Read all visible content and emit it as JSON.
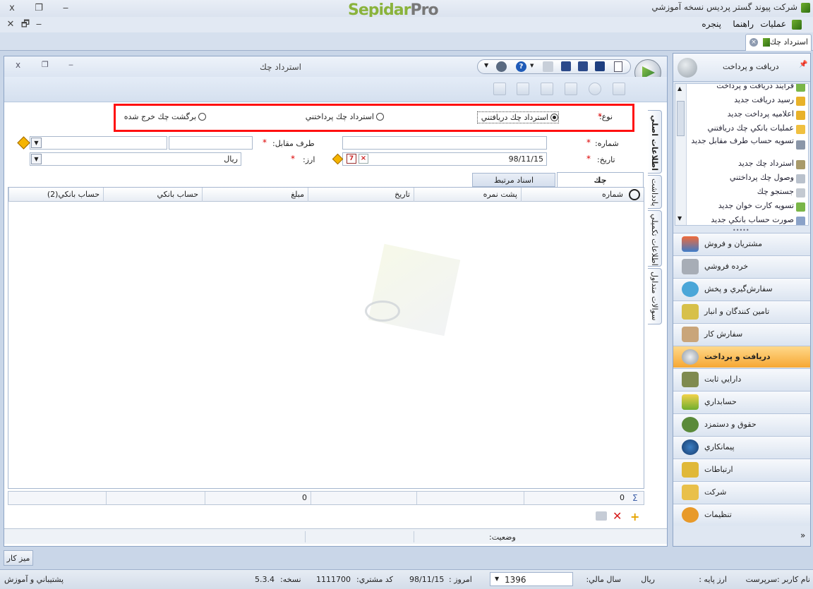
{
  "window": {
    "title": "شرکت پیوند گستر پردیس نسخه آموزشي",
    "logo_part1": "Sepidar",
    "logo_part2": "Pro",
    "close": "x",
    "restore": "❐",
    "minimize": "‒"
  },
  "menu": {
    "items": [
      "عمليات",
      "راهنما",
      "پنجره"
    ],
    "close": "✕",
    "restore": "🗗",
    "minimize": "‒"
  },
  "doc_tab": {
    "label": "استرداد چك"
  },
  "form": {
    "caption": "استرداد چك",
    "type_label": "نوع:",
    "types": [
      "استرداد چك دريافتني",
      "استرداد چك پرداختني",
      "برگشت چك خرج شده"
    ],
    "selected_type": 0,
    "number_label": "شماره:",
    "date_label": "تاريخ:",
    "date_value": "98/11/15",
    "counterparty_label": "طرف مقابل:",
    "currency_label": "ارز:",
    "currency_value": "ريال",
    "tabs": [
      "چك",
      "اسناد مرتبط"
    ],
    "columns": [
      "شماره",
      "پشت نمره",
      "تاريخ",
      "مبلغ",
      "حساب بانكي",
      "حساب بانكي(2)"
    ],
    "footer_count": "0",
    "footer_amount": "0",
    "status_label": "وضعيت:",
    "side_tabs": [
      "اطلاعات اصلي",
      "يادداشت",
      "اطلاعات تكميلي",
      "سوالات متداول"
    ]
  },
  "right_panel": {
    "title": "دريافت و پرداخت",
    "subitems": [
      "فرايند دريافت و پرداخت",
      "رسيد دريافت جديد",
      "اعلاميه پرداخت جديد",
      "عمليات بانكي چك دريافتني",
      "تسويه حساب طرف مقابل جديد",
      "استرداد چك جديد",
      "وصول چك پرداختني",
      "جستجو چك",
      "تسويه كارت خوان جديد",
      "صورت حساب بانكي جديد"
    ],
    "nav": [
      "مشتريان و فروش",
      "خرده فروشي",
      "سفارش‌گيري و پخش",
      "تامين كنندگان و انبار",
      "سفارش كار",
      "دريافت و پرداخت",
      "دارايي ثابت",
      "حسابداري",
      "حقوق و دستمزد",
      "پيمانكاري",
      "ارتباطات",
      "شركت",
      "تنظيمات"
    ],
    "active_nav": 5,
    "expand": "»"
  },
  "desk_button": "ميز كار",
  "status": {
    "user": "نام كاربر :سرپرست",
    "base_currency": "ارز پايه :",
    "base_currency_value": "ريال",
    "fiscal_year_label": "سال مالي:",
    "fiscal_year": "1396",
    "today_label": "امروز :",
    "today": "98/11/15",
    "customer_code_label": "كد مشتري:",
    "customer_code": "1111700",
    "version_label": "نسخه:",
    "version": "5.3.4",
    "support": "پشتيباني و آموزش"
  },
  "colors": {
    "accent": "#ff1010",
    "active_nav": "#f6a733"
  }
}
